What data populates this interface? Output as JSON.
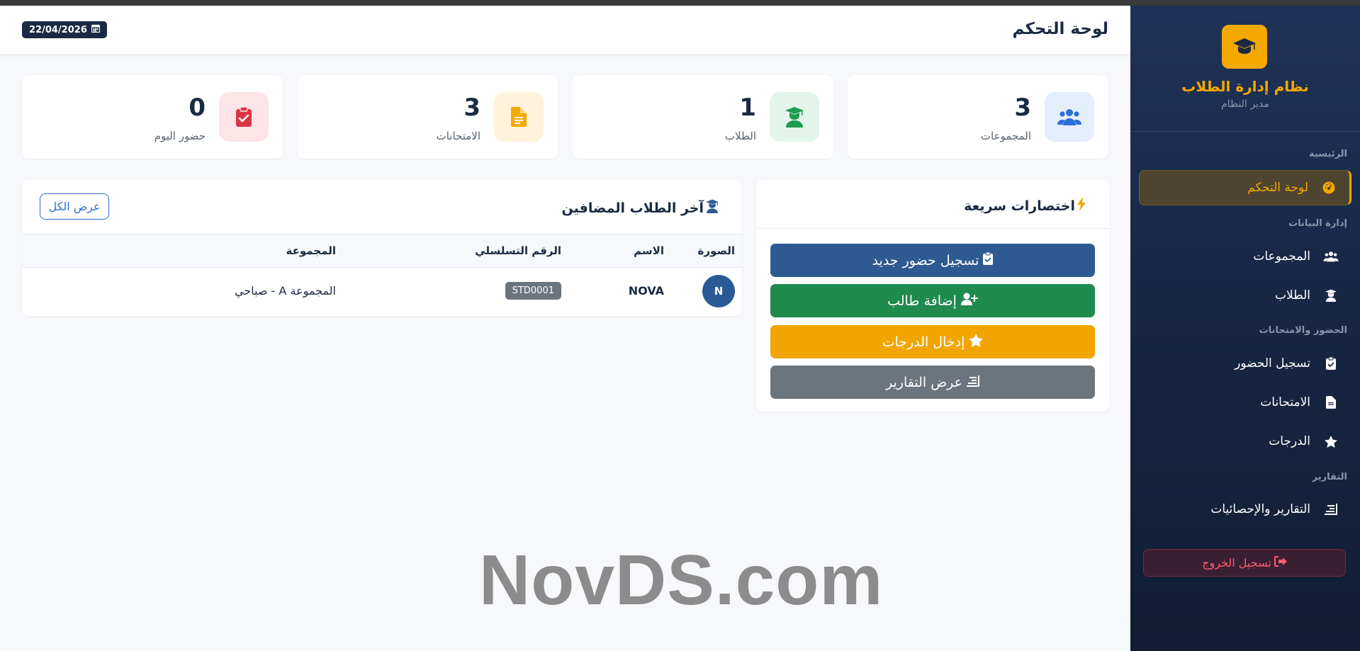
{
  "app": {
    "title": "نظام إدارة الطلاب",
    "role": "مدير النظام",
    "accent": "#f5a800"
  },
  "header": {
    "page_title": "لوحة التحكم",
    "date": "22/04/2026"
  },
  "sidebar": {
    "sections": [
      {
        "label": "الرئيسية"
      },
      {
        "label": "إدارة البيانات"
      },
      {
        "label": "الحضور والامتحانات"
      },
      {
        "label": "التقارير"
      }
    ],
    "items": [
      {
        "label": "لوحة التحكم",
        "icon": "dashboard-icon",
        "active": true
      },
      {
        "label": "المجموعات",
        "icon": "users-icon"
      },
      {
        "label": "الطلاب",
        "icon": "student-icon"
      },
      {
        "label": "تسجيل الحضور",
        "icon": "clipboard-check-icon"
      },
      {
        "label": "الامتحانات",
        "icon": "file-icon"
      },
      {
        "label": "الدرجات",
        "icon": "star-icon"
      },
      {
        "label": "التقارير والإحصائيات",
        "icon": "chart-icon"
      }
    ],
    "logout": "تسجيل الخروج"
  },
  "stats": [
    {
      "label": "المجموعات",
      "value": "3",
      "icon": "users-icon",
      "color": "#2a6fd6",
      "bg": "#e5eefb"
    },
    {
      "label": "الطلاب",
      "value": "1",
      "icon": "graduate-icon",
      "color": "#1e9b4f",
      "bg": "#e3f5ea"
    },
    {
      "label": "الامتحانات",
      "value": "3",
      "icon": "file-icon",
      "color": "#f5a800",
      "bg": "#fff3dc"
    },
    {
      "label": "حضور اليوم",
      "value": "0",
      "icon": "clipboard-check-icon",
      "color": "#dc3545",
      "bg": "#fde4e7"
    }
  ],
  "shortcuts": {
    "title": "اختصارات سريعة",
    "buttons": [
      {
        "label": "تسجيل حضور جديد",
        "icon": "clipboard-check-icon",
        "color": "#2d5a91"
      },
      {
        "label": "إضافة طالب",
        "icon": "user-plus-icon",
        "color": "#1e8a4c"
      },
      {
        "label": "إدخال الدرجات",
        "icon": "star-icon",
        "color": "#f2a500"
      },
      {
        "label": "عرض التقارير",
        "icon": "chart-icon",
        "color": "#6c757d"
      }
    ]
  },
  "recent_students": {
    "title": "آخر الطلاب المضافين",
    "view_all": "عرض الكل",
    "columns": [
      "الصورة",
      "الاسم",
      "الرقم التسلسلي",
      "المجموعة"
    ],
    "rows": [
      {
        "initial": "N",
        "name": "NOVA",
        "serial": "STD0001",
        "group": "المجموعة A - صباحي"
      }
    ]
  },
  "watermark": "NovDS.com"
}
